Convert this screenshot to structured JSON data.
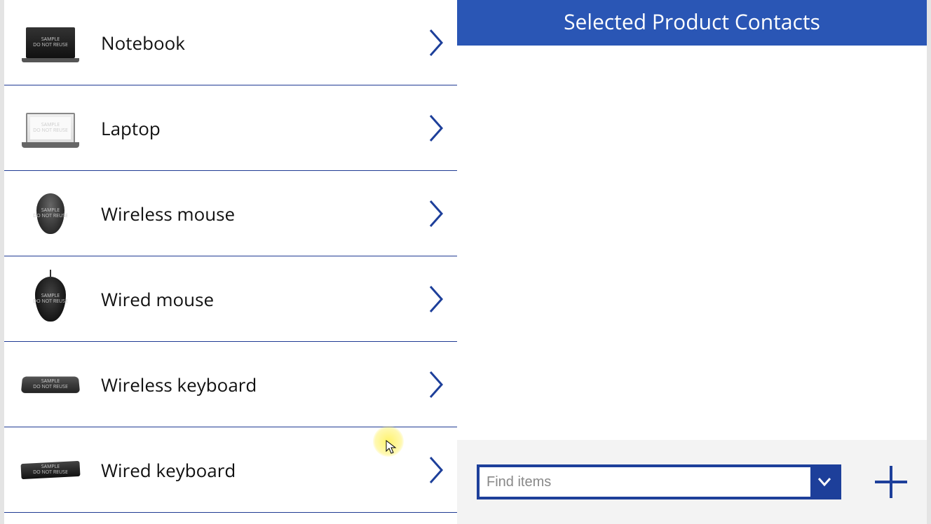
{
  "left": {
    "products": [
      {
        "label": "Notebook",
        "thumb": "notebook"
      },
      {
        "label": "Laptop",
        "thumb": "laptop"
      },
      {
        "label": "Wireless mouse",
        "thumb": "wmouse"
      },
      {
        "label": "Wired mouse",
        "thumb": "wiredmouse"
      },
      {
        "label": "Wireless keyboard",
        "thumb": "wkb"
      },
      {
        "label": "Wired keyboard",
        "thumb": "wiredkb"
      }
    ]
  },
  "right": {
    "header": "Selected Product Contacts",
    "search_placeholder": "Find items"
  },
  "colors": {
    "accent": "#1d3f9a",
    "header": "#2a56b5"
  }
}
